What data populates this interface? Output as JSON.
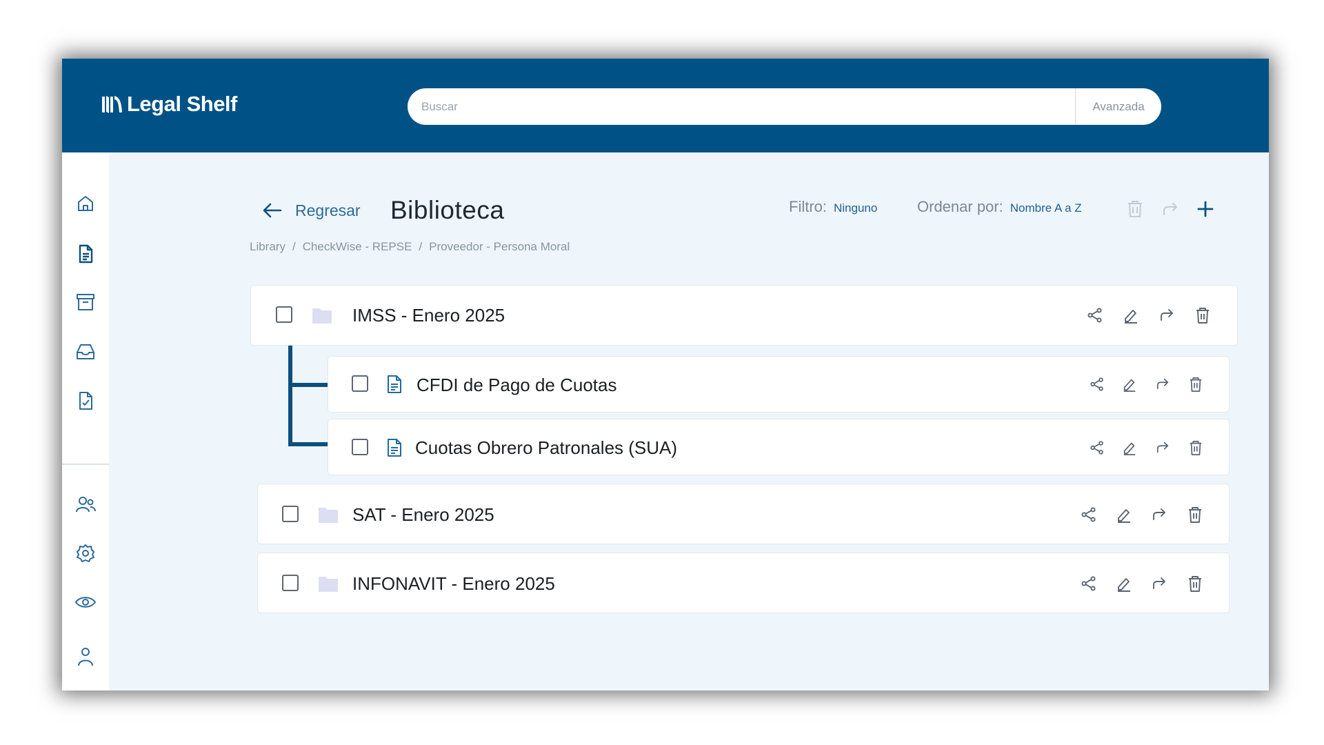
{
  "app": {
    "brand": "Legal Shelf"
  },
  "search": {
    "placeholder": "Buscar",
    "advanced_label": "Avanzada"
  },
  "sidebar": {
    "items": [
      {
        "icon": "home-icon"
      },
      {
        "icon": "document-icon",
        "active": true
      },
      {
        "icon": "archive-icon"
      },
      {
        "icon": "inbox-icon"
      },
      {
        "icon": "checklist-icon"
      },
      {
        "icon": "users-icon"
      },
      {
        "icon": "settings-icon"
      },
      {
        "icon": "eye-icon"
      },
      {
        "icon": "profile-icon"
      }
    ]
  },
  "header": {
    "back_label": "Regresar",
    "title": "Biblioteca",
    "filter_label": "Filtro:",
    "filter_value": "Ninguno",
    "sort_label": "Ordenar por:",
    "sort_value": "Nombre A a Z"
  },
  "breadcrumb": [
    "Library",
    "CheckWise - REPSE",
    "Proveedor - Persona Moral"
  ],
  "breadcrumb_separator": "/",
  "items": [
    {
      "type": "folder",
      "name": "IMSS - Enero 2025",
      "expanded": true,
      "children": [
        {
          "type": "file",
          "name": "CFDI de Pago de Cuotas"
        },
        {
          "type": "file",
          "name": "Cuotas Obrero Patronales (SUA)"
        }
      ]
    },
    {
      "type": "folder",
      "name": "SAT - Enero 2025"
    },
    {
      "type": "folder",
      "name": "INFONAVIT - Enero 2025"
    }
  ],
  "colors": {
    "topbar": "#005286",
    "accent": "#1f5f8f",
    "tree_line": "#0b4f80",
    "folder": "#dcdff2",
    "content_bg": "#eef6fc"
  }
}
